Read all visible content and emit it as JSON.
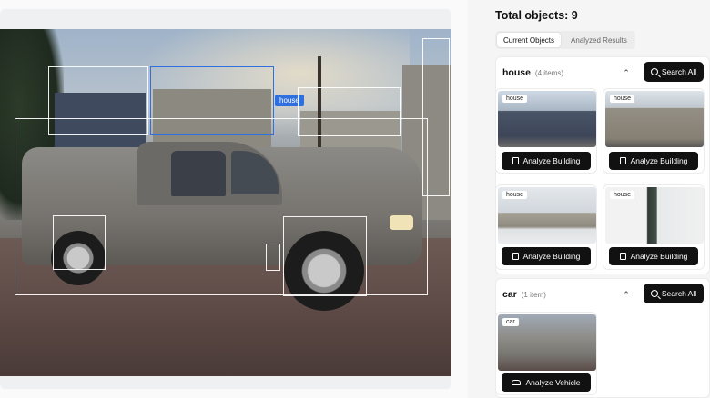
{
  "viewer": {
    "selected_label": "house"
  },
  "panel": {
    "total_objects": "Total objects: 9",
    "tabs": [
      {
        "label": "Current Objects",
        "active": true
      },
      {
        "label": "Analyzed Results",
        "active": false
      }
    ],
    "sections": [
      {
        "title": "house",
        "count": "(4 items)",
        "search_label": "Search All",
        "cards": [
          {
            "tag": "house",
            "button": "Analyze Building"
          },
          {
            "tag": "house",
            "button": "Analyze Building"
          },
          {
            "tag": "house",
            "button": "Analyze Building"
          },
          {
            "tag": "house",
            "button": "Analyze Building"
          }
        ]
      },
      {
        "title": "car",
        "count": "(1 item)",
        "search_label": "Search All",
        "cards": [
          {
            "tag": "car",
            "button": "Analyze Vehicle"
          }
        ]
      }
    ]
  },
  "colors": {
    "accent": "#2f6fe0",
    "button_bg": "#111111",
    "box_outline": "#ffffff"
  },
  "icons": {
    "search": "search-icon",
    "collapse": "chevron-up-icon",
    "building": "building-icon",
    "vehicle": "car-icon"
  }
}
